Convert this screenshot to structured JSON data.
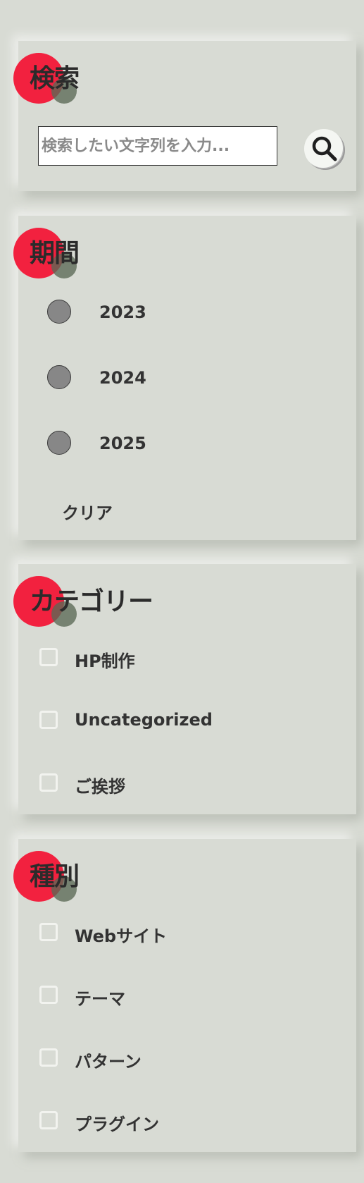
{
  "search": {
    "title": "検索",
    "placeholder": "検索したい文字列を入力...",
    "value": ""
  },
  "period": {
    "title": "期間",
    "options": [
      "2023",
      "2024",
      "2025"
    ],
    "clear_label": "クリア"
  },
  "category": {
    "title": "カテゴリー",
    "options": [
      "HP制作",
      "Uncategorized",
      "ご挨拶"
    ]
  },
  "type": {
    "title": "種別",
    "options": [
      "Webサイト",
      "テーマ",
      "パターン",
      "プラグイン"
    ]
  },
  "colors": {
    "background": "#d8dbd4",
    "accent_red": "#f2213f",
    "accent_green": "#5a6955",
    "radio_fill": "#878787"
  },
  "icons": {
    "search_button": "search-icon"
  }
}
